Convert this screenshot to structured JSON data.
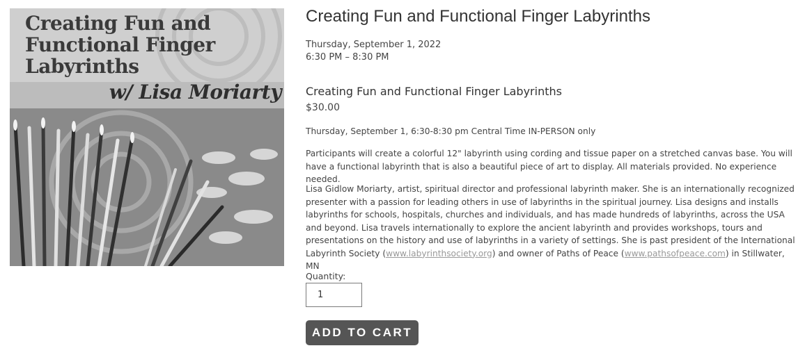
{
  "hero": {
    "title": "Creating Fun and\nFunctional Finger\nLabyrinths",
    "subtitle": "w/ Lisa Moriarty"
  },
  "event": {
    "title": "Creating Fun and Functional Finger Labyrinths",
    "date": "Thursday, September 1, 2022",
    "time": "6:30 PM – 8:30 PM"
  },
  "product": {
    "name": "Creating Fun and Functional Finger Labyrinths",
    "price": "$30.00",
    "schedule": "Thursday, September 1, 6:30-8:30 pm Central Time IN-PERSON only",
    "description": "Participants will create a colorful 12\" labyrinth using cording and tissue paper on a stretched canvas base. You will have a functional labyrinth that is also a beautiful piece of art to display. All materials provided. No experience needed.",
    "bio_part1": "Lisa Gidlow Moriarty, artist, spiritual director and professional labyrinth maker. She is an internationally recognized presenter with a passion for leading others in use of labyrinths in the spiritual journey. Lisa designs and installs labyrinths for schools, hospitals, churches and individuals, and has made hundreds of labyrinths, across the USA and beyond. Lisa travels internationally to explore the ancient labyrinth and provides workshops, tours and presentations on the history and use of labyrinths in a variety of settings. She is past president of the International Labyrinth Society (",
    "bio_link1": "www.labyrinthsociety.org",
    "bio_part2": ") and owner of Paths of Peace (",
    "bio_link2": "www.pathsofpeace.com",
    "bio_part3": ") in Stillwater, MN"
  },
  "cart": {
    "quantity_label": "Quantity:",
    "quantity_value": "1",
    "add_button": "ADD TO CART"
  }
}
